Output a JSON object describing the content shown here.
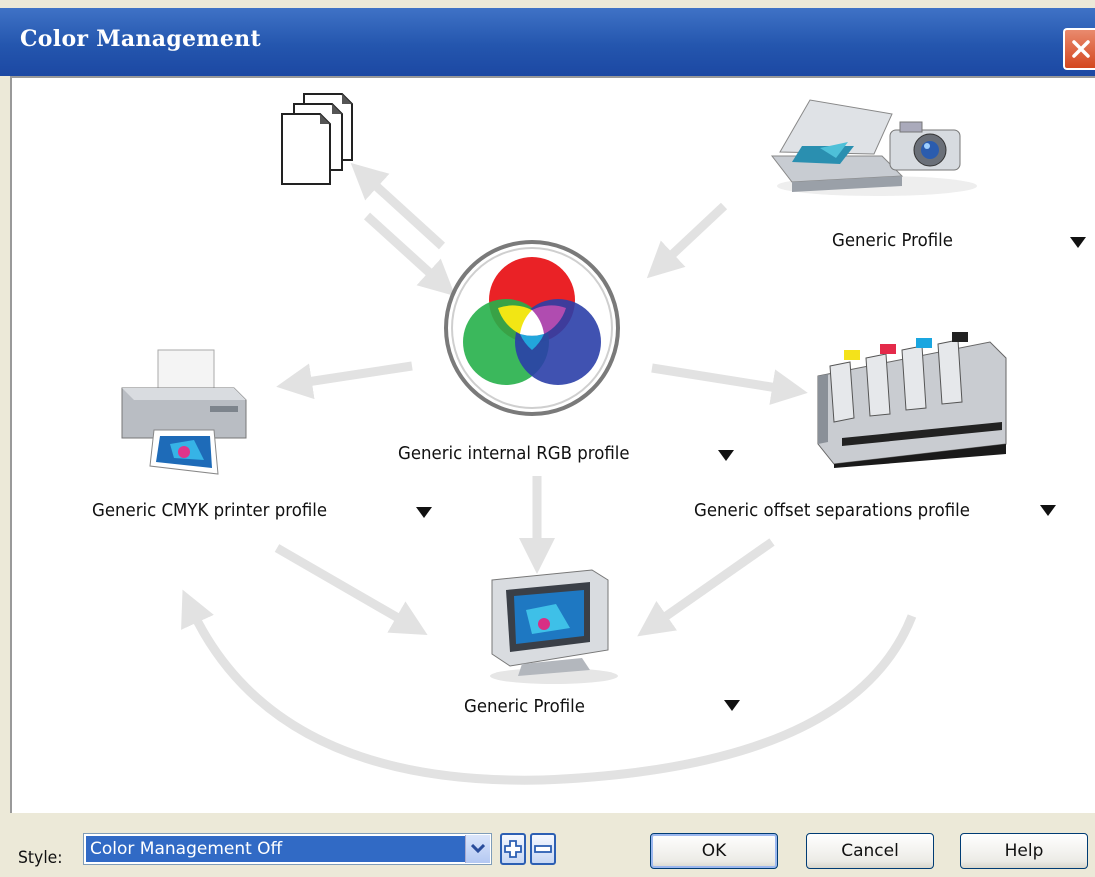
{
  "window": {
    "title": "Color Management"
  },
  "diagram": {
    "input_device": {
      "label": "Generic Profile",
      "icon": "scanner-camera-icon"
    },
    "documents": {
      "icon": "document-stack-icon"
    },
    "internal_rgb": {
      "label": "Generic internal RGB profile",
      "icon": "rgb-color-wheel-icon"
    },
    "composite_printer": {
      "label": "Generic CMYK printer profile",
      "icon": "printer-icon"
    },
    "separations_printer": {
      "label": "Generic offset separations profile",
      "icon": "offset-press-icon"
    },
    "monitor": {
      "label": "Generic Profile",
      "icon": "monitor-icon"
    }
  },
  "footer": {
    "style_label": "Style:",
    "style_value": "Color Management Off",
    "add_icon": "plus-icon",
    "remove_icon": "minus-icon",
    "ok_label": "OK",
    "cancel_label": "Cancel",
    "help_label": "Help"
  },
  "colors": {
    "titlebar": "#2456ae",
    "selection": "#316ac5",
    "close": "#d4471f"
  }
}
